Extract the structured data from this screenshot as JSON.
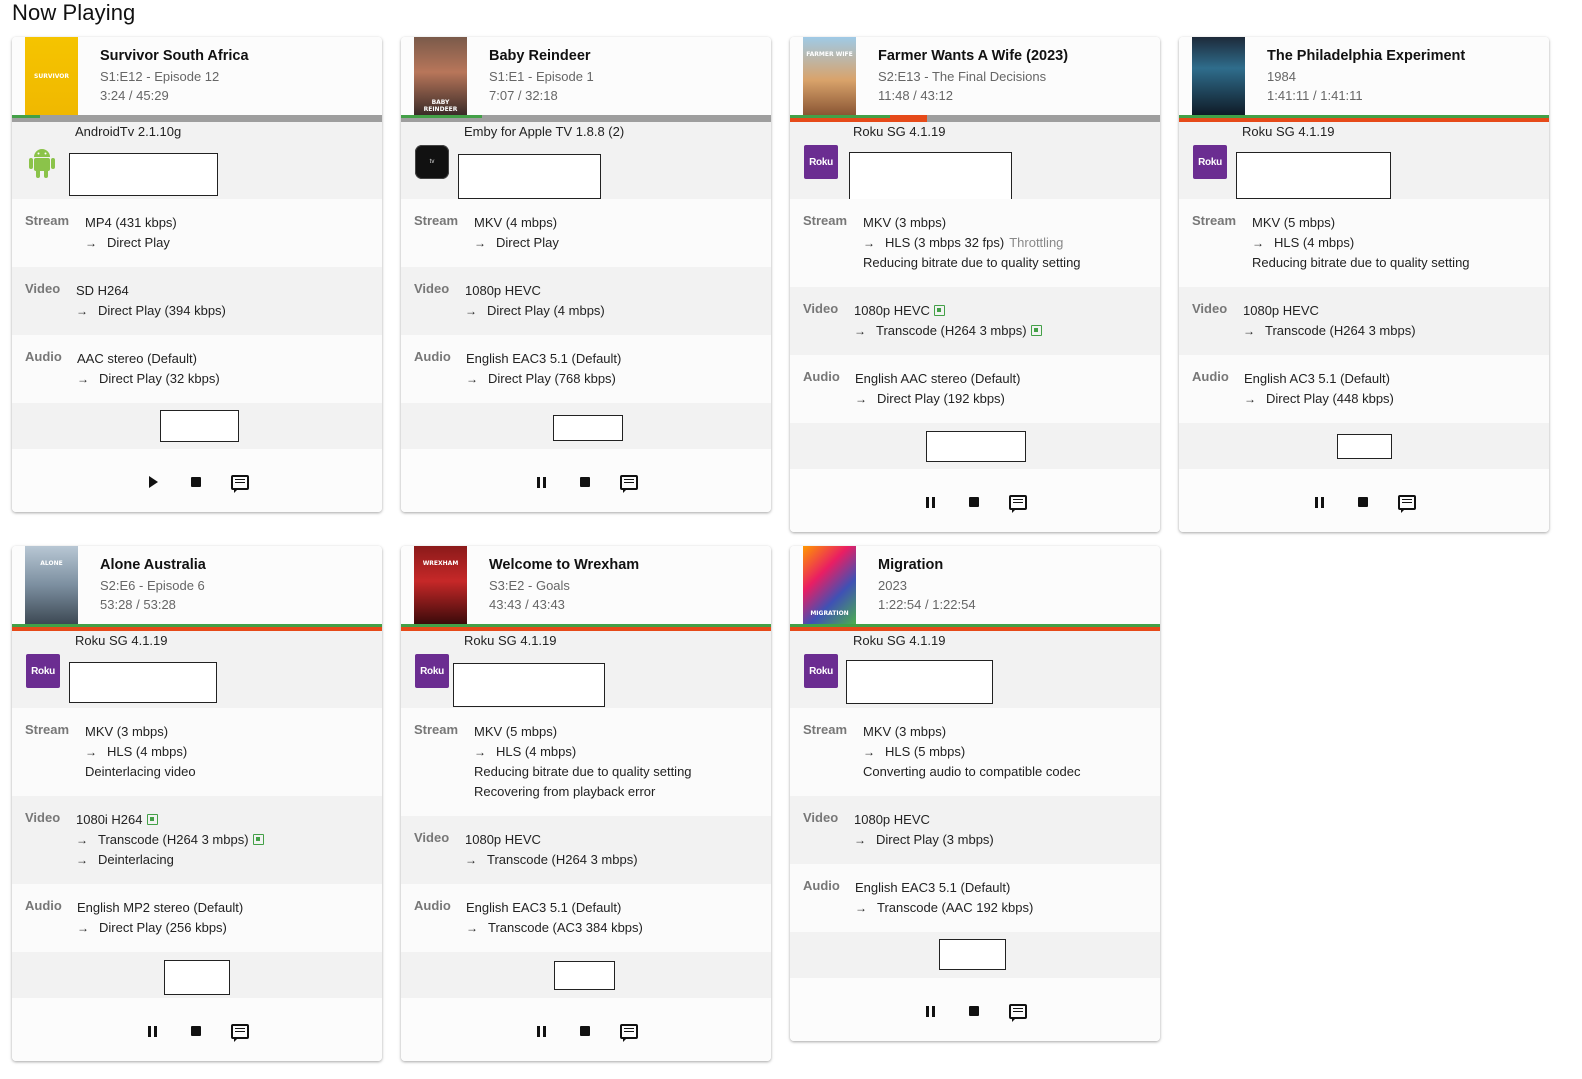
{
  "page_title": "Now Playing",
  "colors": {
    "roku": "#6b2d91",
    "progress_played": "#43a047",
    "progress_transcode": "#e64a19",
    "progress_bg": "#9e9e9e",
    "android": "#8bc34a"
  },
  "icons": {
    "play": "play-icon",
    "pause": "pause-icon",
    "stop": "stop-icon",
    "message": "message-icon",
    "hw_accel": "hardware-acceleration-icon"
  },
  "sessions": [
    {
      "title": "Survivor South Africa",
      "subtitle": "S1:E12 - Episode 12",
      "time": "3:24 / 45:29",
      "progress_played": 0.075,
      "progress_transcode": 0.0,
      "device": "AndroidTv 2.1.10g",
      "device_icon": "android-icon",
      "device_logo": "",
      "stream_label": "Stream",
      "stream": [
        "MP4 (431 kbps)",
        "Direct Play"
      ],
      "video_label": "Video",
      "video": [
        "SD H264",
        "Direct Play (394 kbps)"
      ],
      "audio_label": "Audio",
      "audio": [
        "AAC stereo (Default)",
        "Direct Play (32 kbps)"
      ],
      "state": "paused"
    },
    {
      "title": "Baby Reindeer",
      "subtitle": "S1:E1 - Episode 1",
      "time": "7:07 / 32:18",
      "progress_played": 0.22,
      "progress_transcode": 0.0,
      "device": "Emby for Apple TV 1.8.8 (2)",
      "device_icon": "apple-tv-icon",
      "device_logo": "tv",
      "stream_label": "Stream",
      "stream": [
        "MKV (4 mbps)",
        "Direct Play"
      ],
      "video_label": "Video",
      "video": [
        "1080p HEVC",
        "Direct Play (4 mbps)"
      ],
      "audio_label": "Audio",
      "audio": [
        "English EAC3 5.1 (Default)",
        "Direct Play (768 kbps)"
      ],
      "state": "playing"
    },
    {
      "title": "Farmer Wants A Wife (2023)",
      "subtitle": "S2:E13 - The Final Decisions",
      "time": "11:48 / 43:12",
      "progress_played": 0.27,
      "progress_transcode": 0.37,
      "device": "Roku SG 4.1.19",
      "device_icon": "roku-icon",
      "device_logo": "Roku",
      "stream_label": "Stream",
      "stream": [
        "MKV (3 mbps)",
        "HLS (3 mbps 32 fps)",
        "Reducing bitrate due to quality setting"
      ],
      "stream_note": "Throttling",
      "video_label": "Video",
      "video": [
        "1080p HEVC",
        "Transcode (H264 3 mbps)"
      ],
      "audio_label": "Audio",
      "audio": [
        "English AAC stereo (Default)",
        "Direct Play (192 kbps)"
      ],
      "state": "playing"
    },
    {
      "title": "The Philadelphia Experiment",
      "subtitle": "1984",
      "time": "1:41:11 / 1:41:11",
      "progress_played": 1.0,
      "progress_transcode": 1.0,
      "device": "Roku SG 4.1.19",
      "device_icon": "roku-icon",
      "device_logo": "Roku",
      "stream_label": "Stream",
      "stream": [
        "MKV (5 mbps)",
        "HLS (4 mbps)",
        "Reducing bitrate due to quality setting"
      ],
      "video_label": "Video",
      "video": [
        "1080p HEVC",
        "Transcode (H264 3 mbps)"
      ],
      "audio_label": "Audio",
      "audio": [
        "English AC3 5.1 (Default)",
        "Direct Play (448 kbps)"
      ],
      "state": "playing"
    },
    {
      "title": "Alone Australia",
      "subtitle": "S2:E6 - Episode 6",
      "time": "53:28 / 53:28",
      "progress_played": 1.0,
      "progress_transcode": 1.0,
      "device": "Roku SG 4.1.19",
      "device_icon": "roku-icon",
      "device_logo": "Roku",
      "stream_label": "Stream",
      "stream": [
        "MKV (3 mbps)",
        "HLS (4 mbps)",
        "Deinterlacing video"
      ],
      "video_label": "Video",
      "video": [
        "1080i H264",
        "Transcode (H264 3 mbps)",
        "Deinterlacing"
      ],
      "audio_label": "Audio",
      "audio": [
        "English MP2 stereo (Default)",
        "Direct Play (256 kbps)"
      ],
      "state": "playing"
    },
    {
      "title": "Welcome to Wrexham",
      "subtitle": "S3:E2 - Goals",
      "time": "43:43 / 43:43",
      "progress_played": 1.0,
      "progress_transcode": 1.0,
      "device": "Roku SG 4.1.19",
      "device_icon": "roku-icon",
      "device_logo": "Roku",
      "stream_label": "Stream",
      "stream": [
        "MKV (5 mbps)",
        "HLS (4 mbps)",
        "Reducing bitrate due to quality setting",
        "Recovering from playback error"
      ],
      "video_label": "Video",
      "video": [
        "1080p HEVC",
        "Transcode (H264 3 mbps)"
      ],
      "audio_label": "Audio",
      "audio": [
        "English EAC3 5.1 (Default)",
        "Transcode (AC3 384 kbps)"
      ],
      "state": "playing"
    },
    {
      "title": "Migration",
      "subtitle": "2023",
      "time": "1:22:54 / 1:22:54",
      "progress_played": 1.0,
      "progress_transcode": 1.0,
      "device": "Roku SG 4.1.19",
      "device_icon": "roku-icon",
      "device_logo": "Roku",
      "stream_label": "Stream",
      "stream": [
        "MKV (3 mbps)",
        "HLS (5 mbps)",
        "Converting audio to compatible codec"
      ],
      "video_label": "Video",
      "video": [
        "1080p HEVC",
        "Direct Play (3 mbps)"
      ],
      "audio_label": "Audio",
      "audio": [
        "English EAC3 5.1 (Default)",
        "Transcode (AAC 192 kbps)"
      ],
      "state": "playing"
    }
  ],
  "poster_text": [
    "SURVIVOR",
    "BABY REINDEER",
    "FARMER WIFE",
    "",
    "ALONE",
    "WREXHAM",
    "MIGRATION"
  ]
}
